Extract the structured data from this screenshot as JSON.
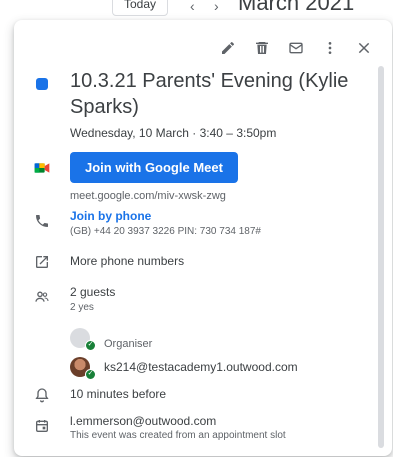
{
  "background": {
    "today_label": "Today",
    "prev_label": "‹",
    "next_label": "›",
    "month_label": "March 2021"
  },
  "toolbar": {
    "edit_icon": "pencil-icon",
    "delete_icon": "trash-icon",
    "email_icon": "mail-icon",
    "more_icon": "more-vert-icon",
    "close_icon": "close-icon"
  },
  "event": {
    "color": "#1a73e8",
    "title": "10.3.21 Parents' Evening (Kylie Sparks)",
    "date_time": "Wednesday, 10 March  ·  3:40 – 3:50pm"
  },
  "meet": {
    "button_label": "Join with Google Meet",
    "link": "meet.google.com/miv-xwsk-zwg"
  },
  "phone": {
    "label": "Join by phone",
    "details": "(GB) +44 20 3937 3226 PIN: 730 734 187#"
  },
  "more_numbers": {
    "label": "More phone numbers"
  },
  "guests": {
    "count_label": "2 guests",
    "rsvp_label": "2 yes",
    "list": [
      {
        "name": "",
        "role": "Organiser"
      },
      {
        "name": "ks214@testacademy1.outwood.com",
        "role": ""
      }
    ]
  },
  "reminder": {
    "label": "10 minutes before"
  },
  "calendar": {
    "owner": "l.emmerson@outwood.com",
    "note": "This event was created from an appointment slot"
  }
}
